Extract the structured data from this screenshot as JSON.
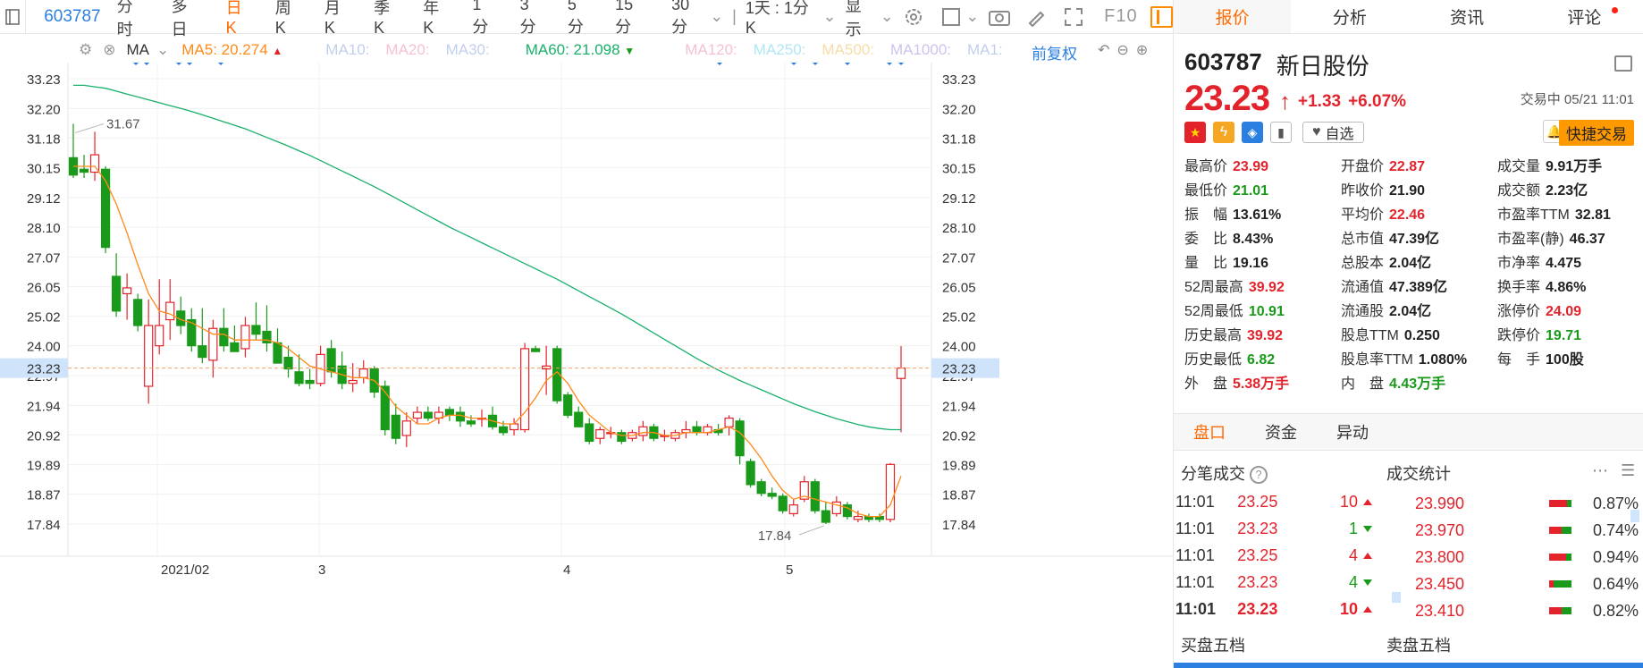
{
  "toolbar": {
    "code": "603787",
    "periods": [
      "分时",
      "多日",
      "日K",
      "周K",
      "月K",
      "季K",
      "年K",
      "1分",
      "3分",
      "5分",
      "15分",
      "30分"
    ],
    "active_period": "日K",
    "range": "1天 : 1分K",
    "display": "显示",
    "f10": "F10"
  },
  "ma_bar": {
    "label": "MA",
    "ma5": "MA5: 20.274",
    "ma10": "MA10:",
    "ma20": "MA20:",
    "ma30": "MA30:",
    "ma60": "MA60: 21.098",
    "ma120": "MA120:",
    "ma250": "MA250:",
    "ma500": "MA500:",
    "ma1000": "MA1000:",
    "ma1": "MA1:",
    "adjust": "前复权",
    "colors": {
      "ma5": "#ff8a1a",
      "ma60": "#18b06a",
      "ma10": "#b8c8e8",
      "ma20": "#f3b3c8",
      "ma30": "#b8c8e8",
      "ma120": "#f3b3c8",
      "ma250": "#9fe0f0",
      "ma500": "#f5d58a",
      "ma1000": "#c8b8e8"
    }
  },
  "chart_data": {
    "type": "candlestick",
    "y_ticks": [
      "33.23",
      "32.20",
      "31.18",
      "30.15",
      "29.12",
      "28.10",
      "27.07",
      "26.05",
      "25.02",
      "24.00",
      "22.97",
      "21.94",
      "20.92",
      "19.89",
      "18.87",
      "17.84"
    ],
    "ylim": [
      17.84,
      33.23
    ],
    "x_labels": [
      "2021/02",
      "3",
      "4",
      "5"
    ],
    "current_price_label": "23.23",
    "annotations": {
      "high": "31.67",
      "low": "17.84"
    },
    "ohlc": [
      [
        30.5,
        31.67,
        29.8,
        29.9
      ],
      [
        30.1,
        30.6,
        29.8,
        30.0
      ],
      [
        30.0,
        31.4,
        29.7,
        30.6
      ],
      [
        30.1,
        30.2,
        27.2,
        27.4
      ],
      [
        26.4,
        27.2,
        25.0,
        25.2
      ],
      [
        25.8,
        26.5,
        24.9,
        26.0
      ],
      [
        25.6,
        25.8,
        24.5,
        24.7
      ],
      [
        22.6,
        25.6,
        22.0,
        24.7
      ],
      [
        24.0,
        26.3,
        23.7,
        24.7
      ],
      [
        24.9,
        26.3,
        24.2,
        25.5
      ],
      [
        25.2,
        25.7,
        24.4,
        24.7
      ],
      [
        24.9,
        25.3,
        23.8,
        24.0
      ],
      [
        24.0,
        25.3,
        23.4,
        23.6
      ],
      [
        23.5,
        24.9,
        22.9,
        24.6
      ],
      [
        24.6,
        25.3,
        23.8,
        24.0
      ],
      [
        24.1,
        24.7,
        23.8,
        23.8
      ],
      [
        23.9,
        25.0,
        23.6,
        24.7
      ],
      [
        24.7,
        25.5,
        24.2,
        24.4
      ],
      [
        24.5,
        25.4,
        23.8,
        24.1
      ],
      [
        24.1,
        24.6,
        23.4,
        23.4
      ],
      [
        23.6,
        24.0,
        22.9,
        23.2
      ],
      [
        23.1,
        23.7,
        22.6,
        22.7
      ],
      [
        22.8,
        23.2,
        22.5,
        22.7
      ],
      [
        22.7,
        24.0,
        22.6,
        23.7
      ],
      [
        23.9,
        24.2,
        22.9,
        23.1
      ],
      [
        23.3,
        23.8,
        22.5,
        22.7
      ],
      [
        22.7,
        23.4,
        22.4,
        22.8
      ],
      [
        22.9,
        23.5,
        22.7,
        23.2
      ],
      [
        23.2,
        23.3,
        22.2,
        22.4
      ],
      [
        22.6,
        22.8,
        20.9,
        21.1
      ],
      [
        21.6,
        22.0,
        20.6,
        20.8
      ],
      [
        20.9,
        21.7,
        20.5,
        21.4
      ],
      [
        21.5,
        21.9,
        21.3,
        21.7
      ],
      [
        21.7,
        21.9,
        21.4,
        21.5
      ],
      [
        21.5,
        21.9,
        21.3,
        21.7
      ],
      [
        21.8,
        21.9,
        21.4,
        21.6
      ],
      [
        21.7,
        21.9,
        21.2,
        21.4
      ],
      [
        21.4,
        21.6,
        21.2,
        21.3
      ],
      [
        21.5,
        21.8,
        21.2,
        21.5
      ],
      [
        21.6,
        21.9,
        21.1,
        21.2
      ],
      [
        21.2,
        21.4,
        20.9,
        21.0
      ],
      [
        21.1,
        21.5,
        20.9,
        21.3
      ],
      [
        21.1,
        24.1,
        21.0,
        23.9
      ],
      [
        23.9,
        24.0,
        23.8,
        23.8
      ],
      [
        23.2,
        24.0,
        22.3,
        23.3
      ],
      [
        23.9,
        24.0,
        22.0,
        22.1
      ],
      [
        22.3,
        22.4,
        21.5,
        21.6
      ],
      [
        21.7,
        21.9,
        21.2,
        21.2
      ],
      [
        21.3,
        21.5,
        20.6,
        20.7
      ],
      [
        20.8,
        21.2,
        20.6,
        21.1
      ],
      [
        21.0,
        21.2,
        20.8,
        21.0
      ],
      [
        21.0,
        21.1,
        20.6,
        20.7
      ],
      [
        20.8,
        21.1,
        20.7,
        21.0
      ],
      [
        20.9,
        21.4,
        20.7,
        21.2
      ],
      [
        21.2,
        21.3,
        20.7,
        20.8
      ],
      [
        20.9,
        21.1,
        20.7,
        20.9
      ],
      [
        20.8,
        21.1,
        20.7,
        21.0
      ],
      [
        21.0,
        21.4,
        20.8,
        21.1
      ],
      [
        21.2,
        21.4,
        20.9,
        21.0
      ],
      [
        21.0,
        21.3,
        20.9,
        21.2
      ],
      [
        21.1,
        21.3,
        20.9,
        21.0
      ],
      [
        21.2,
        21.6,
        20.9,
        21.5
      ],
      [
        21.4,
        21.5,
        19.9,
        20.2
      ],
      [
        20.0,
        20.1,
        19.1,
        19.2
      ],
      [
        19.3,
        19.4,
        18.8,
        18.9
      ],
      [
        18.9,
        19.1,
        18.7,
        18.8
      ],
      [
        18.8,
        18.9,
        18.2,
        18.3
      ],
      [
        18.2,
        18.7,
        18.1,
        18.5
      ],
      [
        18.7,
        19.5,
        18.6,
        19.3
      ],
      [
        19.3,
        19.4,
        18.2,
        18.3
      ],
      [
        18.3,
        18.6,
        17.84,
        17.9
      ],
      [
        18.2,
        18.8,
        18.1,
        18.6
      ],
      [
        18.5,
        18.6,
        18.0,
        18.1
      ],
      [
        18.0,
        18.3,
        17.9,
        18.1
      ],
      [
        18.1,
        18.2,
        17.9,
        18.0
      ],
      [
        18.1,
        18.2,
        17.9,
        18.0
      ],
      [
        18.0,
        19.95,
        17.9,
        19.9
      ],
      [
        22.87,
        23.99,
        21.01,
        23.23
      ]
    ],
    "ma5": [
      30.2,
      30.2,
      30.2,
      29.7,
      28.9,
      27.9,
      26.8,
      25.8,
      25.2,
      25.1,
      24.9,
      24.8,
      24.6,
      24.4,
      24.4,
      24.2,
      24.2,
      24.2,
      24.2,
      24.1,
      23.9,
      23.6,
      23.3,
      23.2,
      23.1,
      23.0,
      22.9,
      22.9,
      22.8,
      22.4,
      21.9,
      21.6,
      21.3,
      21.3,
      21.5,
      21.6,
      21.6,
      21.5,
      21.5,
      21.4,
      21.3,
      21.3,
      21.7,
      22.2,
      22.8,
      23.1,
      22.7,
      22.1,
      21.6,
      21.3,
      21.0,
      20.9,
      20.9,
      21.0,
      21.0,
      20.9,
      20.9,
      21.0,
      21.0,
      21.0,
      21.1,
      21.2,
      21.0,
      20.6,
      20.1,
      19.5,
      19.0,
      18.7,
      18.8,
      18.7,
      18.6,
      18.5,
      18.4,
      18.2,
      18.1,
      18.1,
      18.5,
      19.5
    ],
    "ma60": [
      33.0,
      33.0,
      32.95,
      32.9,
      32.8,
      32.7,
      32.6,
      32.5,
      32.4,
      32.3,
      32.2,
      32.1,
      31.98,
      31.86,
      31.74,
      31.62,
      31.5,
      31.35,
      31.2,
      31.05,
      30.9,
      30.74,
      30.58,
      30.4,
      30.22,
      30.04,
      29.86,
      29.68,
      29.5,
      29.3,
      29.1,
      28.9,
      28.7,
      28.5,
      28.3,
      28.1,
      27.92,
      27.74,
      27.56,
      27.38,
      27.2,
      27.02,
      26.84,
      26.66,
      26.48,
      26.3,
      26.1,
      25.9,
      25.7,
      25.5,
      25.3,
      25.1,
      24.88,
      24.66,
      24.44,
      24.22,
      24.0,
      23.78,
      23.56,
      23.36,
      23.16,
      22.98,
      22.8,
      22.64,
      22.48,
      22.32,
      22.16,
      22.0,
      21.86,
      21.72,
      21.6,
      21.48,
      21.38,
      21.28,
      21.2,
      21.14,
      21.1,
      21.1
    ],
    "markers_x": [
      152,
      164,
      200,
      212,
      247,
      805,
      888,
      912,
      948,
      995,
      1008
    ]
  },
  "right_panel": {
    "tabs": [
      "报价",
      "分析",
      "资讯",
      "评论"
    ],
    "active_tab": "报价",
    "code": "603787",
    "name": "新日股份",
    "price": "23.23",
    "change": "+1.33",
    "change_pct": "+6.07%",
    "status": "交易中 05/21 11:01",
    "watch": "自选",
    "quick_trade": "快捷交易",
    "stats": [
      {
        "k": "最高价",
        "v": "23.99",
        "c": "red"
      },
      {
        "k": "开盘价",
        "v": "22.87",
        "c": "red"
      },
      {
        "k": "成交量",
        "v": "9.91万手",
        "c": "dark"
      },
      {
        "k": "最低价",
        "v": "21.01",
        "c": "green"
      },
      {
        "k": "昨收价",
        "v": "21.90",
        "c": "dark"
      },
      {
        "k": "成交额",
        "v": "2.23亿",
        "c": "dark"
      },
      {
        "k": "振　幅",
        "v": "13.61%",
        "c": "dark"
      },
      {
        "k": "平均价",
        "v": "22.46",
        "c": "red"
      },
      {
        "k": "市盈率TTM",
        "v": "32.81",
        "c": "dark"
      },
      {
        "k": "委　比",
        "v": "8.43%",
        "c": "dark"
      },
      {
        "k": "总市值",
        "v": "47.39亿",
        "c": "dark"
      },
      {
        "k": "市盈率(静)",
        "v": "46.37",
        "c": "dark"
      },
      {
        "k": "量　比",
        "v": "19.16",
        "c": "dark"
      },
      {
        "k": "总股本",
        "v": "2.04亿",
        "c": "dark"
      },
      {
        "k": "市净率",
        "v": "4.475",
        "c": "dark"
      },
      {
        "k": "52周最高",
        "v": "39.92",
        "c": "red"
      },
      {
        "k": "流通值",
        "v": "47.389亿",
        "c": "dark"
      },
      {
        "k": "换手率",
        "v": "4.86%",
        "c": "dark"
      },
      {
        "k": "52周最低",
        "v": "10.91",
        "c": "green"
      },
      {
        "k": "流通股",
        "v": "2.04亿",
        "c": "dark"
      },
      {
        "k": "涨停价",
        "v": "24.09",
        "c": "red"
      },
      {
        "k": "历史最高",
        "v": "39.92",
        "c": "red"
      },
      {
        "k": "股息TTM",
        "v": "0.250",
        "c": "dark"
      },
      {
        "k": "跌停价",
        "v": "19.71",
        "c": "green"
      },
      {
        "k": "历史最低",
        "v": "6.82",
        "c": "green"
      },
      {
        "k": "股息率TTM",
        "v": "1.080%",
        "c": "dark"
      },
      {
        "k": "每　手",
        "v": "100股",
        "c": "dark"
      },
      {
        "k": "外　盘",
        "v": "5.38万手",
        "c": "red"
      },
      {
        "k": "内　盘",
        "v": "4.43万手",
        "c": "green"
      }
    ],
    "sub_tabs": [
      "盘口",
      "资金",
      "异动"
    ],
    "active_sub_tab": "盘口",
    "ticks_title": "分笔成交",
    "dist_title": "成交统计",
    "ticks": [
      {
        "t": "11:01",
        "p": "23.25",
        "q": "10",
        "dir": "up",
        "qc": "red"
      },
      {
        "t": "11:01",
        "p": "23.23",
        "q": "1",
        "dir": "down",
        "qc": "green"
      },
      {
        "t": "11:01",
        "p": "23.25",
        "q": "4",
        "dir": "up",
        "qc": "red"
      },
      {
        "t": "11:01",
        "p": "23.23",
        "q": "4",
        "dir": "down",
        "qc": "green"
      },
      {
        "t": "11:01",
        "p": "23.23",
        "q": "10",
        "dir": "up",
        "qc": "red"
      }
    ],
    "dist": [
      {
        "p": "23.990",
        "pct": "0.87%",
        "r": 0.82
      },
      {
        "p": "23.970",
        "pct": "0.74%",
        "r": 0.55
      },
      {
        "p": "23.800",
        "pct": "0.94%",
        "r": 0.78
      },
      {
        "p": "23.450",
        "pct": "0.64%",
        "r": 0.18
      },
      {
        "p": "23.410",
        "pct": "0.82%",
        "r": 0.55
      }
    ],
    "buy5": "买盘五档",
    "sell5": "卖盘五档"
  }
}
